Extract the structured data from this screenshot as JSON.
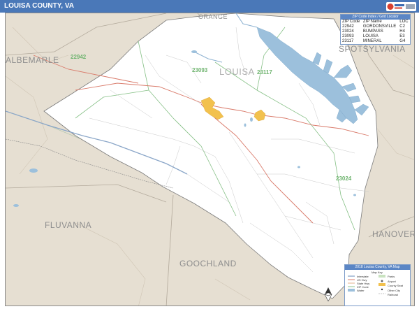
{
  "header": {
    "title": "LOUISA COUNTY, VA"
  },
  "neighbors": [
    {
      "id": "orange",
      "name": "ORANGE"
    },
    {
      "id": "albemarle",
      "name": "ALBEMARLE"
    },
    {
      "id": "spotsylvania",
      "name": "SPOTSYLVANIA"
    },
    {
      "id": "fluvanna",
      "name": "FLUVANNA"
    },
    {
      "id": "goochland",
      "name": "GOOCHLAND"
    },
    {
      "id": "hanover",
      "name": "HANOVER"
    }
  ],
  "county": {
    "name": "LOUISA"
  },
  "zip_labels": [
    "22942",
    "23093",
    "23117",
    "23024"
  ],
  "zip_table": {
    "title": "ZIP Code Index / Grid Locator",
    "columns": [
      "ZIP Code",
      "ZIP Name",
      "LOC"
    ],
    "rows": [
      [
        "22942",
        "GORDONSVILLE",
        "C2"
      ],
      [
        "23024",
        "BUMPASS",
        "H4"
      ],
      [
        "23093",
        "LOUISA",
        "E3"
      ],
      [
        "23117",
        "MINERAL",
        "G4"
      ]
    ]
  },
  "map_key": {
    "title": "2018 Louisa County, VA Map",
    "subtitle": "Map Key",
    "items": [
      "Interstate",
      "US Hwy",
      "State Hwy",
      "ZIP Code",
      "Water",
      "Parks",
      "Airport",
      "County Seat",
      "Other City",
      "Railroad"
    ]
  },
  "colors": {
    "title_bar": "#4a78b8",
    "outside_land": "#e6dfd2",
    "county_fill": "#ffffff",
    "water": "#9cc0dc",
    "zip_boundary": "#6fb46f",
    "major_road": "#d97a6a",
    "city_fill": "#f2c14e"
  }
}
